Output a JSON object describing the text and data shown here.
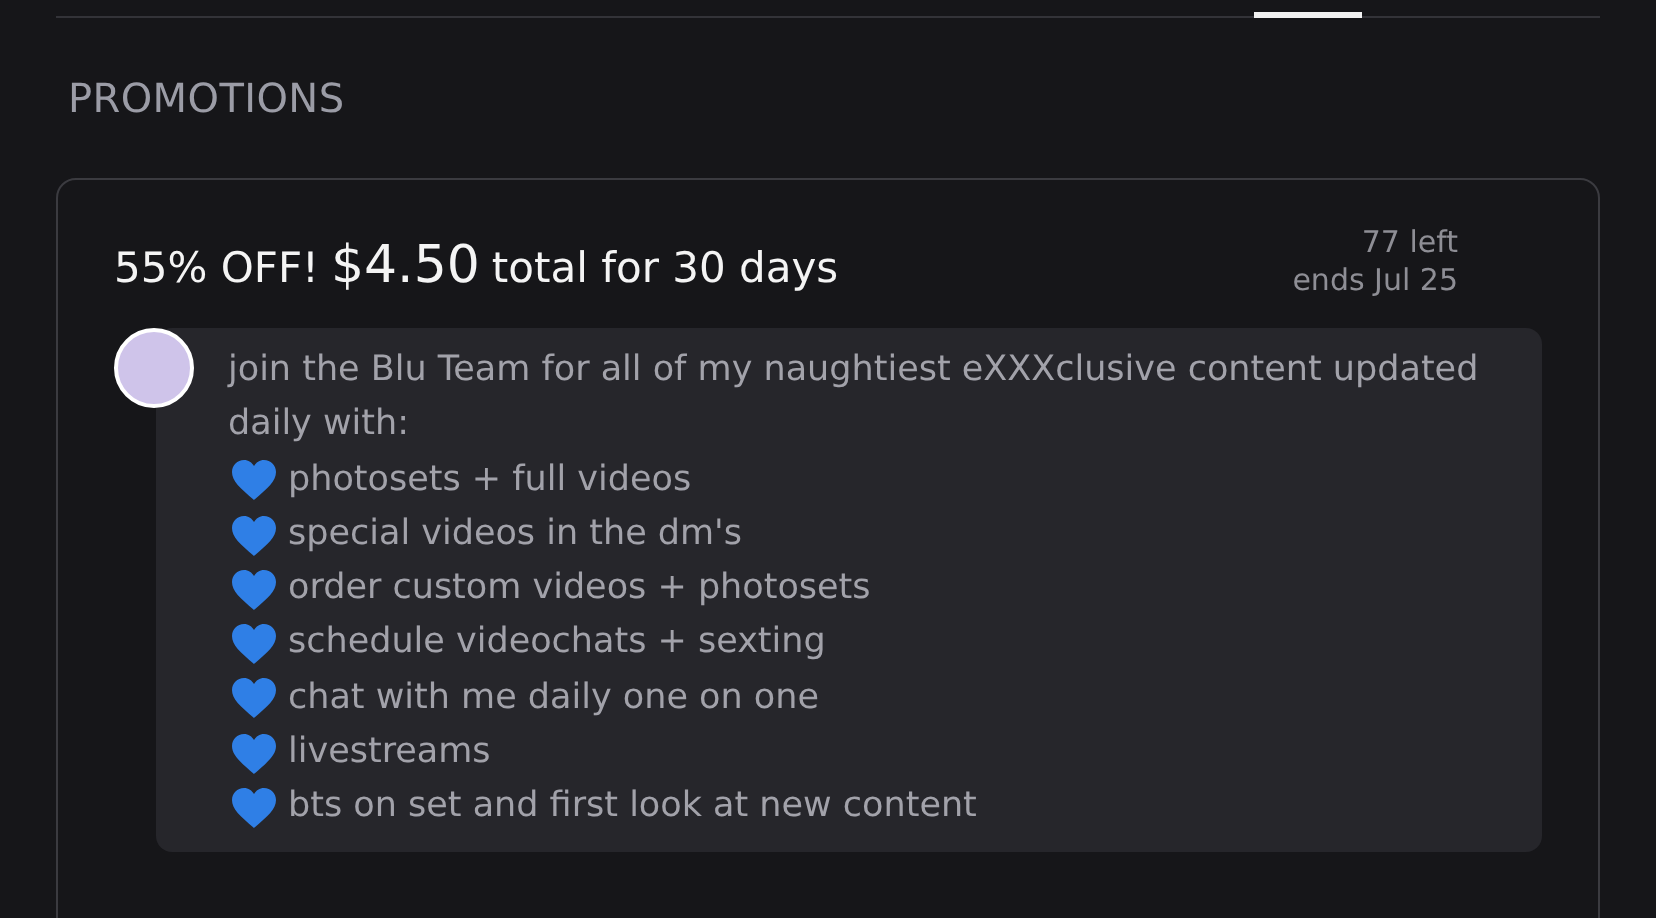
{
  "section_title": "PROMOTIONS",
  "promotion": {
    "discount": "55% OFF!",
    "price": "$4.50",
    "terms": "total for 30 days",
    "remaining": "77 left",
    "ends": "ends Jul 25",
    "description": {
      "intro": "join the Blu Team for all of my naughtiest eXXXclusive content updated daily with:",
      "perks": [
        {
          "text": "photosets + full videos"
        },
        {
          "text": "special videos in the dm's"
        },
        {
          "text": "order custom videos + photosets"
        },
        {
          "text": "schedule videochats + sexting"
        },
        {
          "text": "chat with me daily one on one"
        },
        {
          "text": "livestreams"
        },
        {
          "text": "bts on set and first look at new content"
        }
      ]
    }
  }
}
